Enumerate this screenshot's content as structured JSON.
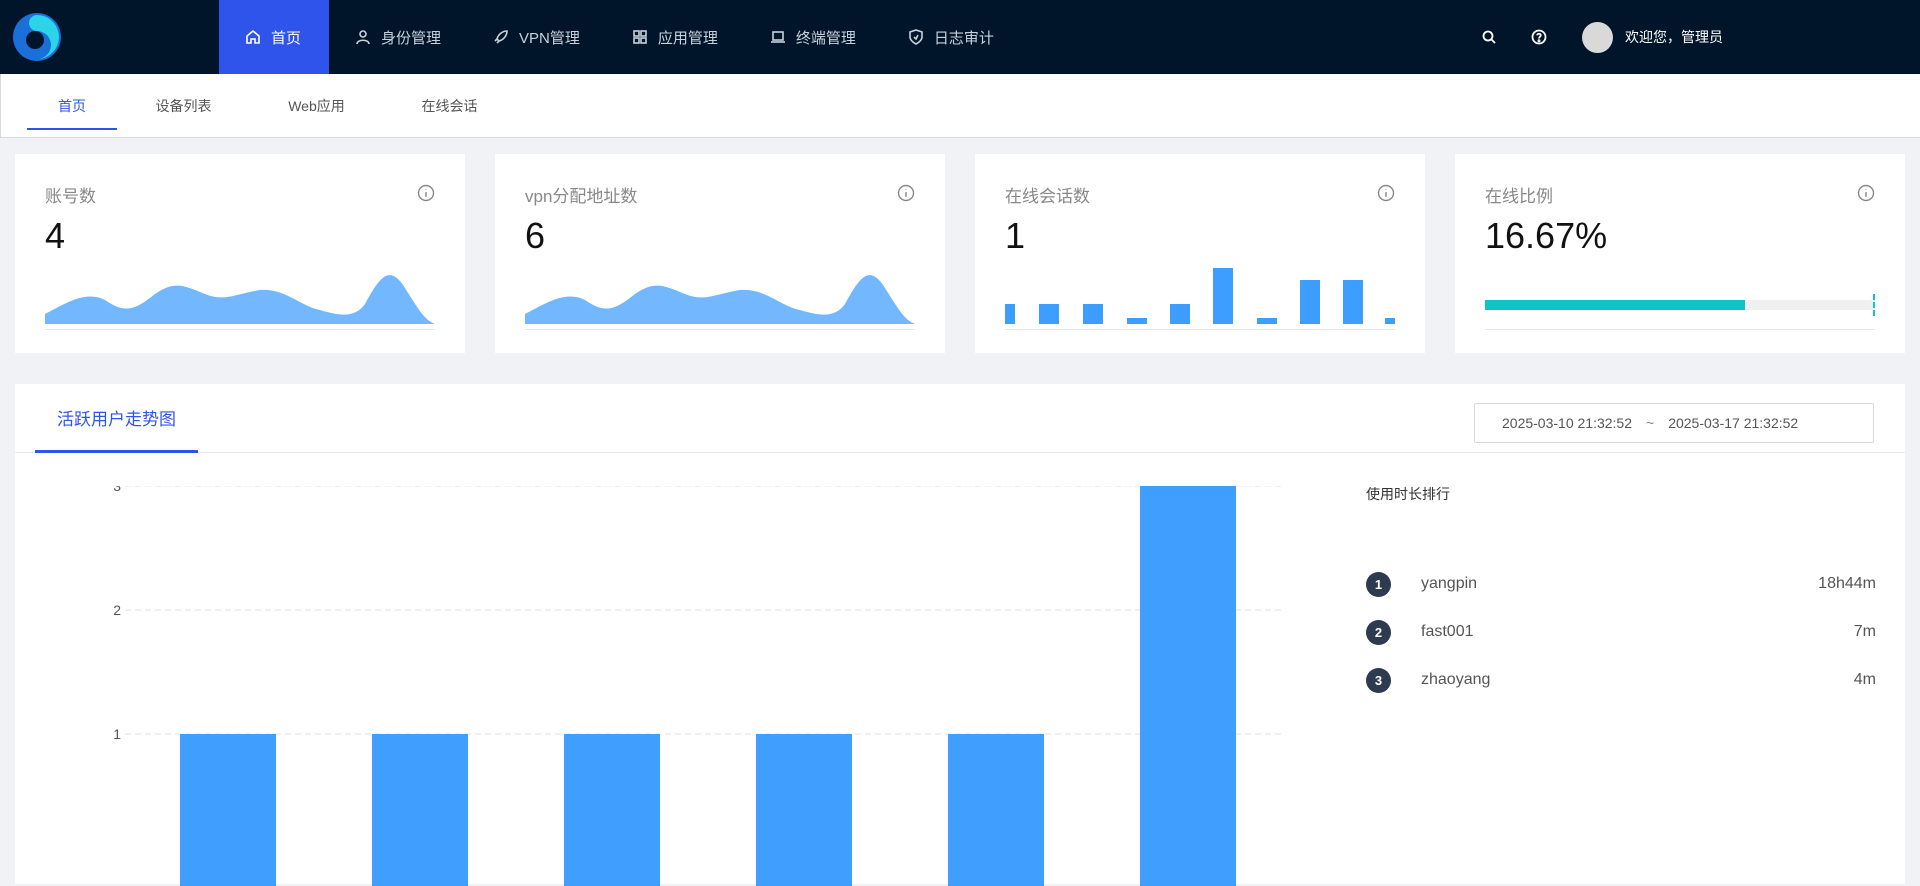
{
  "nav": {
    "items": [
      {
        "label": "首页",
        "icon": "home-icon"
      },
      {
        "label": "身份管理",
        "icon": "user-icon"
      },
      {
        "label": "VPN管理",
        "icon": "rocket-icon"
      },
      {
        "label": "应用管理",
        "icon": "apps-icon"
      },
      {
        "label": "终端管理",
        "icon": "laptop-icon"
      },
      {
        "label": "日志审计",
        "icon": "shield-icon"
      }
    ],
    "welcome": "欢迎您，管理员"
  },
  "subtabs": [
    "首页",
    "设备列表",
    "Web应用",
    "在线会话"
  ],
  "cards": [
    {
      "title": "账号数",
      "value": "4"
    },
    {
      "title": "vpn分配地址数",
      "value": "6"
    },
    {
      "title": "在线会话数",
      "value": "1"
    },
    {
      "title": "在线比例",
      "value": "16.67%",
      "progress": 0.6667
    }
  ],
  "panel": {
    "tab": "活跃用户走势图",
    "date_start": "2025-03-10 21:32:52",
    "date_sep": "~",
    "date_end": "2025-03-17 21:32:52"
  },
  "chart_data": {
    "type": "bar",
    "categories": [
      "",
      "",
      "",
      "",
      "",
      "",
      ""
    ],
    "values": [
      1,
      1,
      1,
      1,
      1,
      3,
      null
    ],
    "yticks": [
      1,
      2,
      3
    ],
    "ylim": [
      0,
      3
    ],
    "grid": true,
    "color": "#409eff"
  },
  "ranking": {
    "title": "使用时长排行",
    "items": [
      {
        "rank": "1",
        "name": "yangpin",
        "time": "18h44m"
      },
      {
        "rank": "2",
        "name": "fast001",
        "time": "7m"
      },
      {
        "rank": "3",
        "name": "zhaoyang",
        "time": "4m"
      }
    ]
  },
  "colors": {
    "nav_bg": "#001529",
    "accent": "#2f54eb",
    "bar": "#409eff",
    "progress": "#13c2c2"
  }
}
